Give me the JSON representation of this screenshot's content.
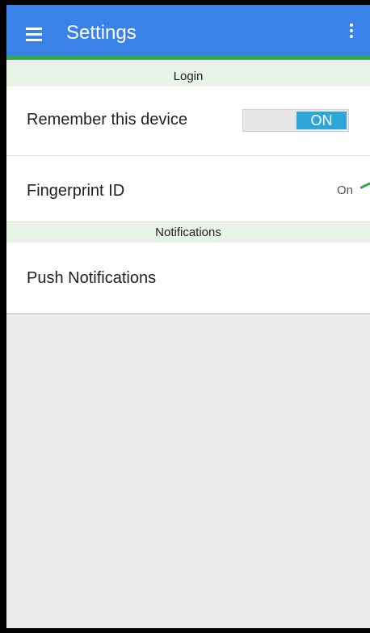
{
  "app": {
    "title": "Settings"
  },
  "sections": {
    "login": {
      "header": "Login"
    },
    "notifications": {
      "header": "Notifications"
    }
  },
  "rows": {
    "remember_device": {
      "label": "Remember this device",
      "toggle_label": "ON"
    },
    "fingerprint": {
      "label": "Fingerprint ID",
      "value": "On"
    },
    "push_notifications": {
      "label": "Push Notifications"
    }
  },
  "colors": {
    "appbar": "#3b82e8",
    "accent_green": "#2fa84f",
    "toggle_on": "#2ea7d8",
    "section_bg": "#e6f3e6",
    "background": "#ececec"
  },
  "icons": {
    "menu": "menu-icon",
    "overflow": "more-vert-icon",
    "arrow": "arrow-icon"
  }
}
